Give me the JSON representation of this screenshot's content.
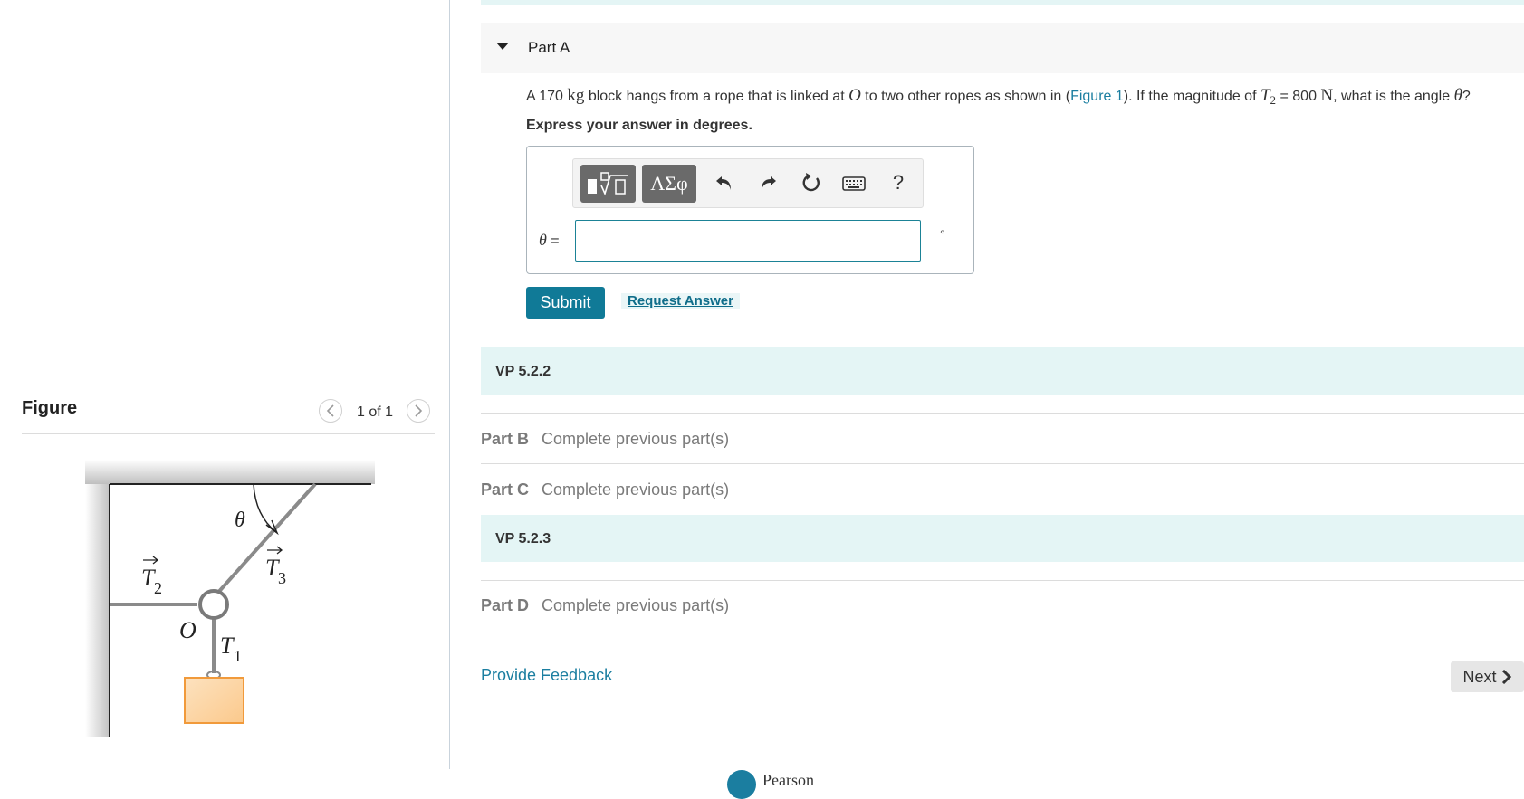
{
  "figure_panel": {
    "title": "Figure",
    "counter": "1 of 1",
    "prev_icon": "chevron-left-icon",
    "next_icon": "chevron-right-icon",
    "diagram_labels": {
      "theta": "θ",
      "t3": "T",
      "t3_sub": "3",
      "t2": "T",
      "t2_sub": "2",
      "o": "O",
      "t1": "T",
      "t1_sub": "1"
    },
    "block_color": "#f7b771",
    "rope_color": "#8a8a8a"
  },
  "part_a": {
    "title": "Part A",
    "question": {
      "p1": "A 170 ",
      "kg": "kg",
      "p2": " block hangs from a rope that is linked at ",
      "o": "O",
      "p3": " to two other ropes as shown in (",
      "link": "Figure 1",
      "p4": "). If the magnitude of ",
      "t": "T",
      "t_sub": "2",
      "p5": " = 800 ",
      "n": "N",
      "p6": ", what is the angle ",
      "theta": "θ",
      "p7": "?"
    },
    "instruction": "Express your answer in degrees.",
    "toolbar": {
      "greek": "ΑΣφ",
      "help": "?",
      "icons": [
        "templates-icon",
        "greek-icon",
        "undo-icon",
        "redo-icon",
        "reset-icon",
        "keyboard-icon",
        "help-icon"
      ]
    },
    "answer": {
      "symbol": "θ",
      "equals": " =",
      "value": "",
      "unit": "°"
    },
    "submit": "Submit",
    "request": "Request Answer"
  },
  "sections": [
    {
      "label": "VP 5.2.2"
    },
    {
      "part": "Part B",
      "status": "Complete previous part(s)"
    },
    {
      "part": "Part C",
      "status": "Complete previous part(s)"
    },
    {
      "label": "VP 5.2.3"
    },
    {
      "part": "Part D",
      "status": "Complete previous part(s)"
    }
  ],
  "footer": {
    "feedback": "Provide Feedback",
    "next": "Next",
    "brand": "Pearson"
  },
  "colors": {
    "accent": "#107a97",
    "link": "#1b7ea0",
    "band": "#e4f5f5"
  }
}
